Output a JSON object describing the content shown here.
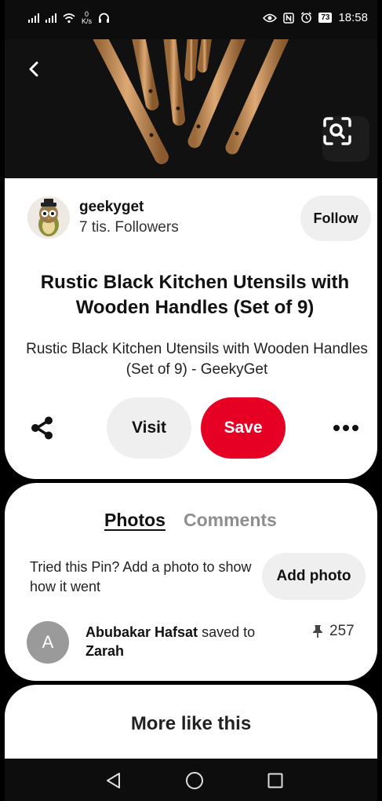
{
  "status_bar": {
    "speed_value": "0",
    "speed_unit": "K/s",
    "battery": "73",
    "time": "18:58"
  },
  "hero": {
    "back_icon": "chevron-left-icon",
    "lens_icon": "visual-search-icon"
  },
  "creator": {
    "name": "geekyget",
    "followers": "7 tis. Followers",
    "follow_label": "Follow"
  },
  "pin": {
    "title": "Rustic Black Kitchen Utensils with Wooden Handles (Set of 9)",
    "description": "Rustic Black Kitchen Utensils with Wooden Handles (Set of 9) - GeekyGet"
  },
  "actions": {
    "share_icon": "share-icon",
    "visit_label": "Visit",
    "save_label": "Save",
    "more_icon": "more-options-icon"
  },
  "comments_section": {
    "tabs": [
      {
        "label": "Photos",
        "active": true
      },
      {
        "label": "Comments",
        "active": false
      }
    ],
    "add_photo_prompt": "Tried this Pin? Add a photo to show how it went",
    "add_photo_label": "Add photo",
    "saver": {
      "initial": "A",
      "name": "Abubakar Hafsat",
      "action": "saved to",
      "board": "Zarah",
      "save_count": "257"
    }
  },
  "more_like_this": {
    "title": "More like this"
  },
  "colors": {
    "save_red": "#e60023",
    "button_grey": "#efefef",
    "inactive_tab": "#8e8e8e"
  }
}
